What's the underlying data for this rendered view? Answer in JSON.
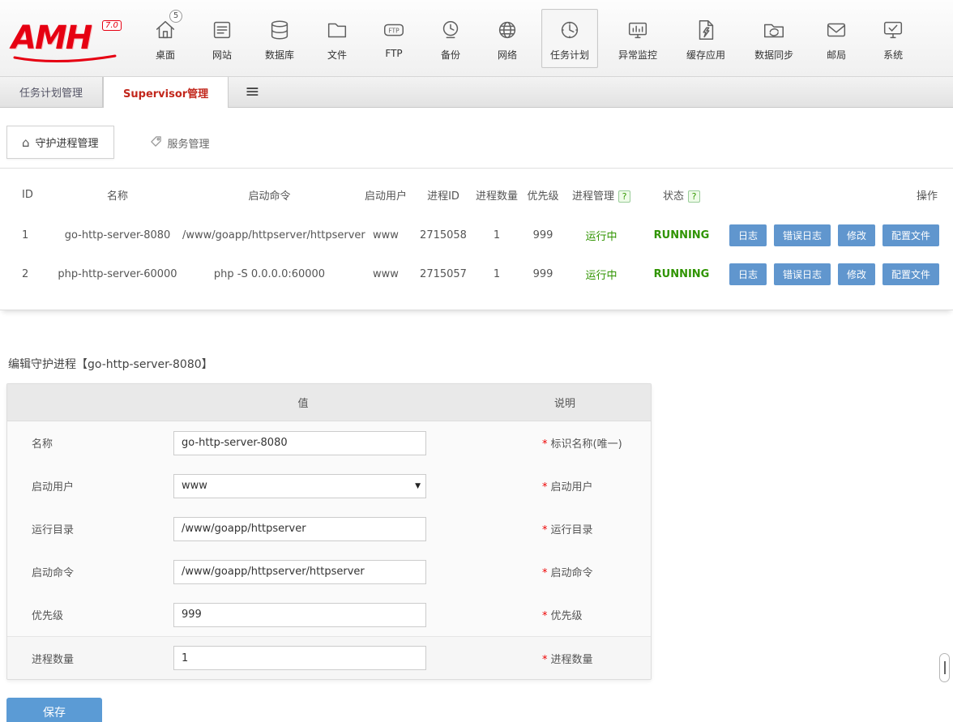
{
  "colors": {
    "brand_red": "#e60012",
    "active_tab_red": "#c2271c",
    "button_blue": "#6096ce",
    "status_green": "#2f9400"
  },
  "icons": {
    "hamburger": "≡",
    "home": "⌂",
    "help": "?",
    "select_arrow": "▼"
  },
  "header": {
    "logo": "AMH",
    "logo_version": "7.0",
    "badge_count": "5",
    "nav_items": [
      {
        "label": "桌面"
      },
      {
        "label": "网站"
      },
      {
        "label": "数据库"
      },
      {
        "label": "文件"
      },
      {
        "label": "FTP"
      },
      {
        "label": "备份"
      },
      {
        "label": "网络"
      },
      {
        "label": "任务计划"
      },
      {
        "label": "异常监控"
      },
      {
        "label": "缓存应用"
      },
      {
        "label": "数据同步"
      },
      {
        "label": "邮局"
      },
      {
        "label": "系统"
      }
    ]
  },
  "subnav": {
    "tabs": [
      {
        "label": "任务计划管理"
      },
      {
        "label": "Supervisor管理"
      }
    ]
  },
  "page_tabs": [
    {
      "label": "守护进程管理"
    },
    {
      "label": "服务管理"
    }
  ],
  "process_table": {
    "columns": [
      "ID",
      "名称",
      "启动命令",
      "启动用户",
      "进程ID",
      "进程数量",
      "优先级",
      "进程管理",
      "状态",
      "操作"
    ],
    "rows": [
      {
        "id": "1",
        "name": "go-http-server-8080",
        "command": "/www/goapp/httpserver/httpserver",
        "user": "www",
        "pid": "2715058",
        "count": "1",
        "priority": "999",
        "manage": "运行中",
        "status": "RUNNING",
        "actions": [
          "日志",
          "错误日志",
          "修改",
          "配置文件"
        ]
      },
      {
        "id": "2",
        "name": "php-http-server-60000",
        "command": "php -S 0.0.0.0:60000",
        "user": "www",
        "pid": "2715057",
        "count": "1",
        "priority": "999",
        "manage": "运行中",
        "status": "RUNNING",
        "actions": [
          "日志",
          "错误日志",
          "修改",
          "配置文件"
        ]
      }
    ]
  },
  "edit_form": {
    "title": "编辑守护进程【go-http-server-8080】",
    "col_value": "值",
    "col_desc": "说明",
    "required_mark": "*",
    "fields": [
      {
        "label": "名称",
        "value": "go-http-server-8080",
        "desc": "标识名称(唯一)"
      },
      {
        "label": "启动用户",
        "value": "www",
        "desc": "启动用户"
      },
      {
        "label": "运行目录",
        "value": "/www/goapp/httpserver",
        "desc": "运行目录"
      },
      {
        "label": "启动命令",
        "value": "/www/goapp/httpserver/httpserver",
        "desc": "启动命令"
      },
      {
        "label": "优先级",
        "value": "999",
        "desc": "优先级"
      },
      {
        "label": "进程数量",
        "value": "1",
        "desc": "进程数量"
      }
    ],
    "save_label": "保存"
  }
}
